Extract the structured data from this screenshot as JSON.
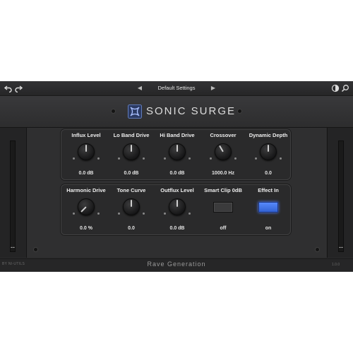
{
  "toolbar": {
    "undo_icon": "undo-arrow-icon",
    "redo_icon": "redo-arrow-icon",
    "prev_icon": "triangle-left-icon",
    "next_icon": "triangle-right-icon",
    "preset_name": "Default Settings",
    "compare_icon": "half-circle-icon",
    "search_icon": "magnifier-icon"
  },
  "header": {
    "logo_icon": "x-star-logo",
    "title": "SONIC SURGE"
  },
  "meters": {
    "left_readout": "--",
    "right_readout": "--"
  },
  "panel_top": [
    {
      "label": "Influx Level",
      "value": "0.0 dB"
    },
    {
      "label": "Lo Band Drive",
      "value": "0.0 dB"
    },
    {
      "label": "Hi Band Drive",
      "value": "0.0 dB"
    },
    {
      "label": "Crossover",
      "value": "1000.0 Hz"
    },
    {
      "label": "Dynamic Depth",
      "value": "0.0"
    }
  ],
  "panel_bottom": [
    {
      "label": "Harmonic Drive",
      "value": "0.0 %"
    },
    {
      "label": "Tone Curve",
      "value": "0.0"
    },
    {
      "label": "Outflux Level",
      "value": "0.0 dB"
    },
    {
      "label": "Smart Clip 0dB",
      "value": "off",
      "state": false
    },
    {
      "label": "Effect In",
      "value": "on",
      "state": true
    }
  ],
  "footer": {
    "left_text": "BY NI-UTILS",
    "brand": "Rave Generation",
    "version": "1.0.0"
  },
  "colors": {
    "background": "#2a2a2b",
    "accent_blue": "#4a78f0",
    "text": "#eeeeee"
  }
}
